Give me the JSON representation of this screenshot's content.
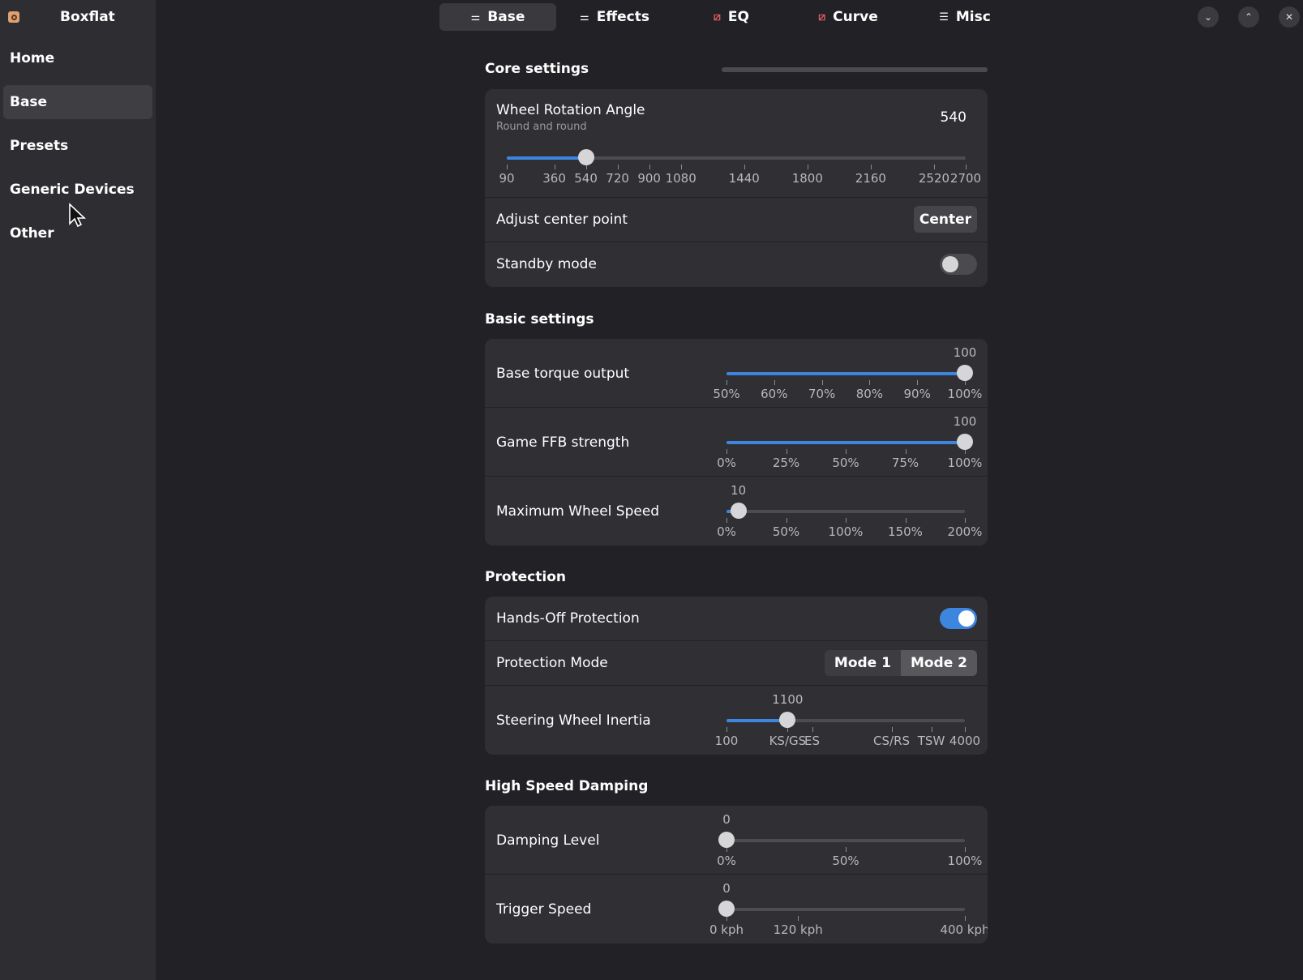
{
  "app": {
    "title": "Boxflat"
  },
  "sidebar": {
    "items": [
      {
        "label": "Home"
      },
      {
        "label": "Base"
      },
      {
        "label": "Presets"
      },
      {
        "label": "Generic Devices"
      },
      {
        "label": "Other"
      }
    ],
    "active_index": 1
  },
  "tabs": [
    {
      "label": "Base",
      "icon": "sliders-icon"
    },
    {
      "label": "Effects",
      "icon": "sliders-icon"
    },
    {
      "label": "EQ",
      "icon": "eq-icon"
    },
    {
      "label": "Curve",
      "icon": "curve-icon"
    },
    {
      "label": "Misc",
      "icon": "menu-icon"
    }
  ],
  "window": {
    "buttons": [
      "chevron-down-icon",
      "chevron-up-icon",
      "close-icon"
    ]
  },
  "sections": {
    "core": {
      "title": "Core settings",
      "rotation": {
        "label": "Wheel Rotation Angle",
        "subtitle": "Round and round",
        "value": "540",
        "min": 90,
        "max": 2700,
        "current": 540,
        "ticks": [
          "90",
          "360",
          "540",
          "720",
          "900",
          "1080",
          "1440",
          "1800",
          "2160",
          "2520",
          "2700"
        ],
        "tick_values": [
          90,
          360,
          540,
          720,
          900,
          1080,
          1440,
          1800,
          2160,
          2520,
          2700
        ]
      },
      "center": {
        "label": "Adjust center point",
        "button": "Center"
      },
      "standby": {
        "label": "Standby mode",
        "on": false
      }
    },
    "basic": {
      "title": "Basic settings",
      "torque": {
        "label": "Base torque output",
        "value": "100",
        "fraction": 1.0,
        "ticks": [
          "50%",
          "60%",
          "70%",
          "80%",
          "90%",
          "100%"
        ]
      },
      "ffb": {
        "label": "Game FFB strength",
        "value": "100",
        "fraction": 1.0,
        "ticks": [
          "0%",
          "25%",
          "50%",
          "75%",
          "100%"
        ]
      },
      "speed": {
        "label": "Maximum Wheel Speed",
        "value": "10",
        "fraction": 0.05,
        "ticks": [
          "0%",
          "50%",
          "100%",
          "150%",
          "200%"
        ]
      }
    },
    "protection": {
      "title": "Protection",
      "handsoff": {
        "label": "Hands-Off Protection",
        "on": true
      },
      "mode": {
        "label": "Protection Mode",
        "options": [
          "Mode 1",
          "Mode 2"
        ],
        "selected": 1
      },
      "inertia": {
        "label": "Steering Wheel Inertia",
        "value": "1100",
        "min": 100,
        "max": 4000,
        "current": 1100,
        "ticks": [
          "100",
          "KS/GS",
          "ES",
          "CS/RS",
          "TSW",
          "4000"
        ],
        "tick_values": [
          100,
          1100,
          1500,
          2800,
          3450,
          4000
        ]
      }
    },
    "damping": {
      "title": "High Speed Damping",
      "level": {
        "label": "Damping Level",
        "value": "0",
        "fraction": 0,
        "ticks": [
          "0%",
          "50%",
          "100%"
        ]
      },
      "trigger": {
        "label": "Trigger Speed",
        "value": "0",
        "min": 0,
        "max": 400,
        "current": 0,
        "ticks": [
          "0 kph",
          "120 kph",
          "400 kph"
        ],
        "tick_values": [
          0,
          120,
          400
        ]
      }
    }
  },
  "colors": {
    "accent": "#3d86e0",
    "background": "#222226",
    "card": "#2f2f34"
  }
}
